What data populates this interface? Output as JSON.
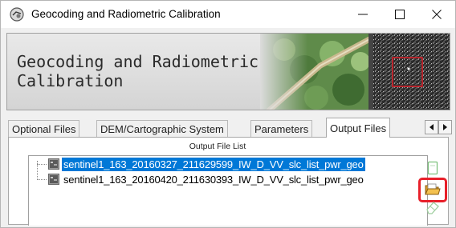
{
  "window": {
    "title": "Geocoding and Radiometric Calibration",
    "controls": {
      "minimize": "—",
      "maximize": "☐",
      "close": "✕"
    }
  },
  "banner": {
    "title": "Geocoding and Radiometric\nCalibration"
  },
  "tabs": [
    {
      "label": "Optional Files",
      "active": false
    },
    {
      "label": "DEM/Cartographic System",
      "active": false
    },
    {
      "label": "Parameters",
      "active": false
    },
    {
      "label": "Output Files",
      "active": true
    }
  ],
  "tab_scroll": {
    "left": "◂",
    "right": "▸"
  },
  "output_panel": {
    "list_title": "Output File List",
    "files": [
      {
        "name": "sentinel1_163_20160327_211629599_IW_D_VV_slc_list_pwr_geo",
        "selected": true
      },
      {
        "name": "sentinel1_163_20160420_211630393_IW_D_VV_slc_list_pwr_geo",
        "selected": false
      }
    ]
  },
  "side_tools": [
    {
      "icon": "new-file-icon",
      "state": "disabled"
    },
    {
      "icon": "open-folder-icon",
      "state": "highlighted"
    },
    {
      "icon": "eraser-icon",
      "state": "disabled"
    }
  ],
  "colors": {
    "selection": "#0078d7",
    "highlight_box": "#e8202a",
    "tool_green": "#4caf50"
  }
}
